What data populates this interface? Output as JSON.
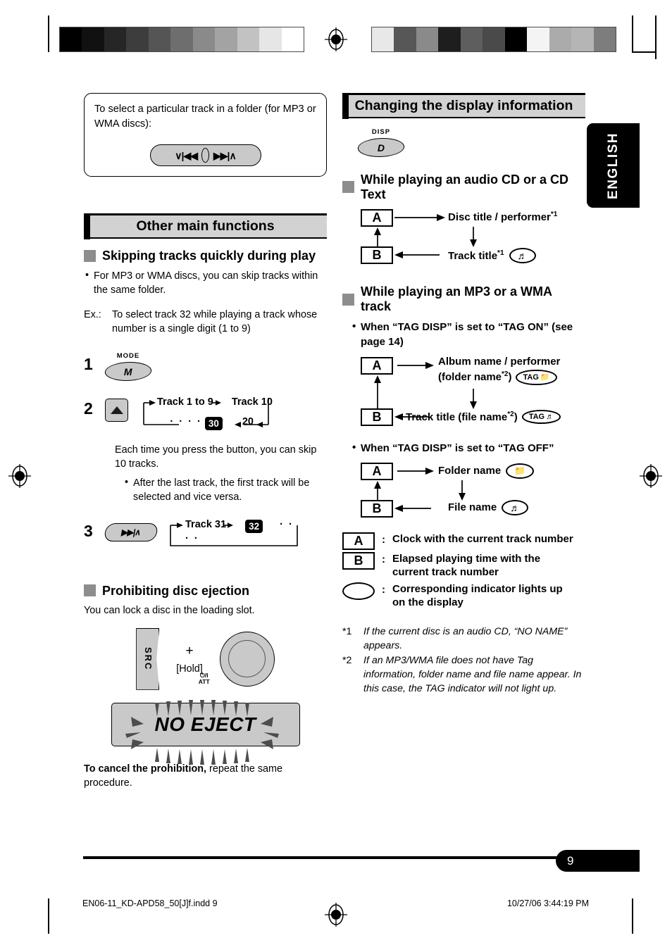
{
  "document": {
    "language_tab": "ENGLISH",
    "page_number": "9",
    "footer_left": "EN06-11_KD-APD58_50[J]f.indd   9",
    "footer_right": "10/27/06   3:44:19 PM"
  },
  "left_column": {
    "notebox": {
      "text": "To select a particular track in a folder (for MP3 or WMA discs):",
      "button": {
        "name": "track-seek-rocker",
        "left_glyph": "∨|◀◀",
        "right_glyph": "▶▶|∧"
      }
    },
    "banner": "Other main functions",
    "section1": {
      "heading": "Skipping tracks quickly during play",
      "bullets": [
        "For MP3 or WMA discs, you can skip tracks within the same folder."
      ],
      "example_label": "Ex.:",
      "example_text": "To select track 32 while playing a track whose number is a single digit (1 to 9)",
      "steps": [
        {
          "number": "1",
          "button_caption": "MODE",
          "button_glyph": "M"
        },
        {
          "number": "2",
          "button_glyph": "▲",
          "flow": {
            "top": [
              "Track 1 to 9",
              "Track 10"
            ],
            "bottom_dots": "· · · ·",
            "bottom_badge": "30",
            "bottom_value": "20"
          },
          "note": "Each time you press the button, you can skip 10 tracks.",
          "sub_bullets": [
            "After the last track, the first track will be selected and vice versa."
          ]
        },
        {
          "number": "3",
          "button_glyph": "▶▶|∧",
          "flow": {
            "first": "Track 31",
            "badge": "32",
            "dots": "· · · ·"
          }
        }
      ]
    },
    "section2": {
      "heading": "Prohibiting disc ejection",
      "intro": "You can lock a disc in the loading slot.",
      "keys": {
        "src_label": "S\nR\nC",
        "plus": "+",
        "hold": "[Hold]",
        "knob_caption_top": "⏻/I",
        "knob_caption_bottom": "ATT"
      },
      "display_text": "NO EJECT",
      "cancel_bold": "To cancel the prohibition,",
      "cancel_rest": " repeat the same procedure."
    }
  },
  "right_column": {
    "banner": "Changing the display information",
    "disp_button": {
      "caption": "DISP",
      "glyph": "D"
    },
    "section1": {
      "heading": "While playing an audio CD or a CD Text",
      "diagram": {
        "box_a": "A",
        "box_b": "B",
        "top_text": "Disc title / performer",
        "top_footnote": "*1",
        "bottom_text": "Track title",
        "bottom_footnote": "*1",
        "bottom_indicator": "music-note"
      }
    },
    "section2": {
      "heading": "While playing an MP3 or a WMA track",
      "case_on": {
        "bullet": "When “TAG DISP” is set to “TAG ON” (see page 14)",
        "box_a": "A",
        "box_b": "B",
        "top_line1": "Album name / performer",
        "top_line2_pre": "(folder name",
        "top_line2_fn": "*2",
        "top_line2_post": ")",
        "top_indicator": "TAG",
        "bottom_pre": "Track title (file name",
        "bottom_fn": "*2",
        "bottom_post": ")",
        "bottom_indicator": "TAG"
      },
      "case_off": {
        "bullet": "When “TAG DISP” is set to “TAG OFF”",
        "box_a": "A",
        "box_b": "B",
        "top_text": "Folder name",
        "top_indicator": "folder",
        "bottom_text": "File name",
        "bottom_indicator": "music-note"
      }
    },
    "legend": [
      {
        "symbol": "A",
        "colon": ":",
        "text": "Clock with the current track number"
      },
      {
        "symbol": "B",
        "colon": ":",
        "text": "Elapsed playing time with the current track number"
      },
      {
        "symbol": "oval",
        "colon": ":",
        "text": "Corresponding indicator lights up on the display"
      }
    ],
    "footnotes": [
      {
        "mark": "*1",
        "text": "If the current disc is an audio CD, “NO NAME” appears."
      },
      {
        "mark": "*2",
        "text": "If an MP3/WMA file does not have Tag information, folder name and file name appear. In this case, the TAG indicator will not light up."
      }
    ]
  },
  "print_marks": {
    "colorbar_left": [
      "#000000",
      "#111111",
      "#262626",
      "#3d3d3d",
      "#555555",
      "#6e6e6e",
      "#8a8a8a",
      "#a3a3a3",
      "#c2c2c2",
      "#e6e6e6",
      "#ffffff"
    ],
    "colorbar_right": [
      "#e8e8e8",
      "#575757",
      "#8a8a8a",
      "#1e1e1e",
      "#5e5e5e",
      "#4a4a4a",
      "#000000",
      "#f4f4f4",
      "#ababab",
      "#b5b5b5",
      "#7d7d7d"
    ]
  }
}
